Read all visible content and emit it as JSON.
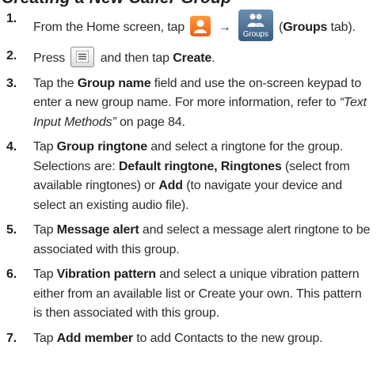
{
  "heading": "Creating a New Caller Group",
  "steps": {
    "s1": {
      "num": "1.",
      "t1": "From the Home screen, tap",
      "arrow": "→",
      "groups_label": "Groups",
      "t2": "(",
      "b1": "Groups",
      "t3": "tab)."
    },
    "s2": {
      "num": "2.",
      "t1": "Press",
      "t2": "and then tap",
      "b1": "Create",
      "t3": "."
    },
    "s3": {
      "num": "3.",
      "t1": "Tap the",
      "b1": "Group name",
      "t2": "field and use the on-screen keypad to enter a new group name. For more information, refer to",
      "i1": "“Text Input Methods”",
      "t3": "on page 84."
    },
    "s4": {
      "num": "4.",
      "t1": "Tap",
      "b1": "Group ringtone",
      "t2": "and select a ringtone for the group. Selections are:",
      "b2": "Default ringtone, Ringtones",
      "t3": "(select from available ringtones) or",
      "b3": "Add",
      "t4": "(to navigate your device and select an existing audio file)."
    },
    "s5": {
      "num": "5.",
      "t1": "Tap",
      "b1": "Message alert",
      "t2": "and select a message alert ringtone to be associated with this group."
    },
    "s6": {
      "num": "6.",
      "t1": "Tap",
      "b1": "Vibration pattern",
      "t2": "and select a unique vibration pattern either from an available list or Create your own. This pattern is then associated with this group."
    },
    "s7": {
      "num": "7.",
      "t1": "Tap",
      "b1": "Add member",
      "t2": "to add Contacts to the new group."
    }
  },
  "icons": {
    "contacts": "contacts-app-icon",
    "groups": "groups-tab-icon",
    "menu": "menu-key-icon"
  },
  "colors": {
    "contacts_icon": "#f0601a",
    "groups_icon": "#3a5c80"
  }
}
